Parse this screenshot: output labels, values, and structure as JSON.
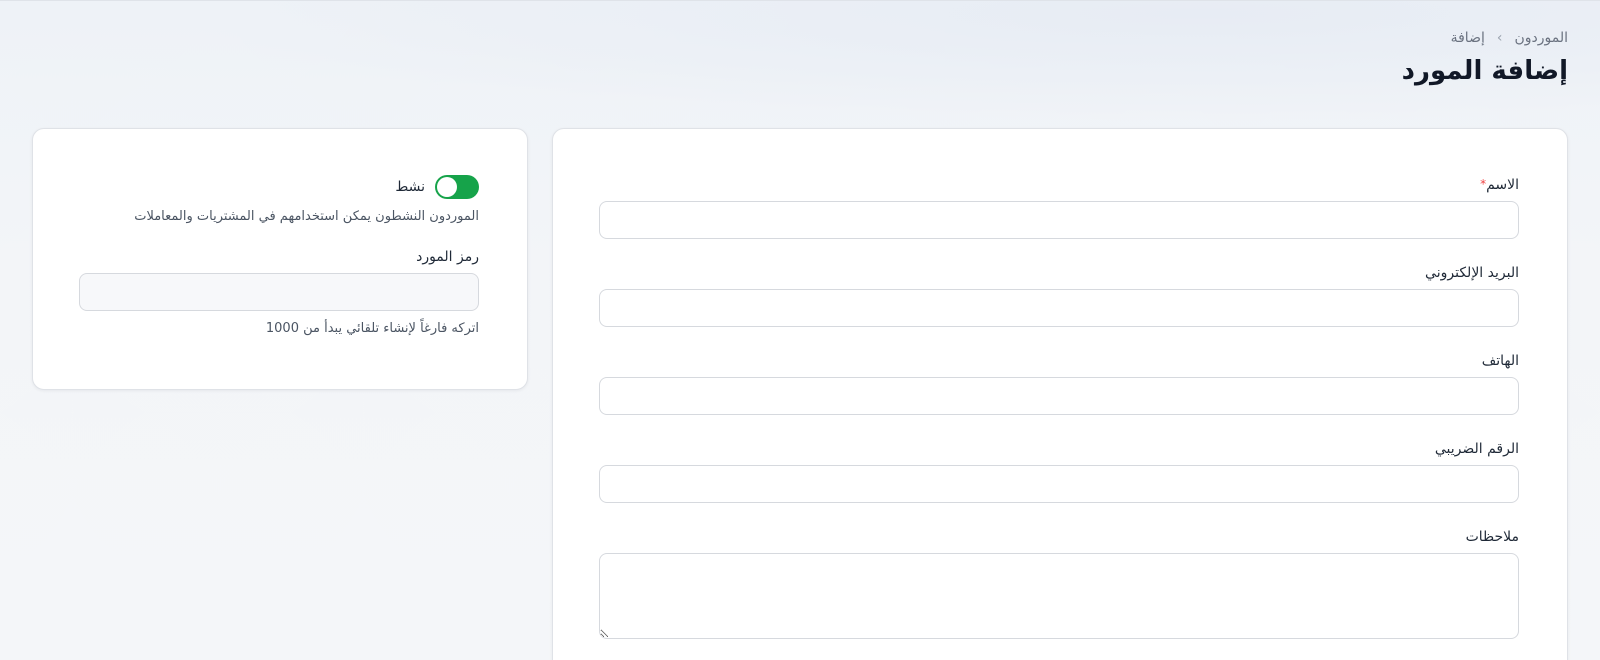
{
  "breadcrumb": {
    "parent": "الموردون",
    "separator": "›",
    "current": "إضافة"
  },
  "page_title": "إضافة المورد",
  "form": {
    "name": {
      "label": "الاسم",
      "required_mark": "*",
      "value": ""
    },
    "email": {
      "label": "البريد الإلكتروني",
      "value": ""
    },
    "phone": {
      "label": "الهاتف",
      "value": ""
    },
    "tax_number": {
      "label": "الرقم الضريبي",
      "value": ""
    },
    "notes": {
      "label": "ملاحظات",
      "value": ""
    }
  },
  "side": {
    "active_toggle": {
      "label": "نشط",
      "state": "on",
      "color": "#16a34a"
    },
    "active_hint": "الموردون النشطون يمكن استخدامهم في المشتريات والمعاملات",
    "supplier_code": {
      "label": "رمز المورد",
      "value": "",
      "hint": "اتركه فارغاً لإنشاء تلقائي يبدأ من 1000"
    }
  }
}
